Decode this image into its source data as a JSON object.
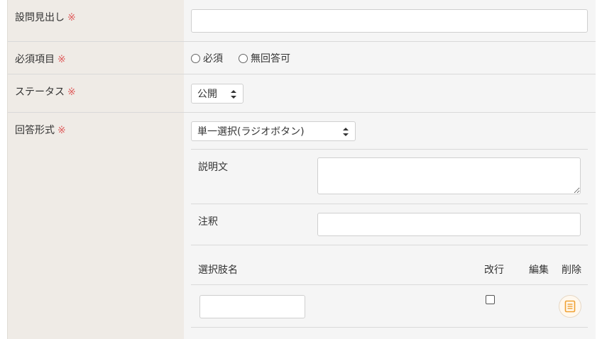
{
  "form": {
    "required_mark": "※",
    "question_title": {
      "label": "設問見出し",
      "value": ""
    },
    "required_item": {
      "label": "必須項目",
      "options": [
        "必須",
        "無回答可"
      ]
    },
    "status": {
      "label": "ステータス",
      "selected": "公開"
    },
    "answer_format": {
      "label": "回答形式",
      "selected": "単一選択(ラジオボタン)",
      "description": {
        "label": "説明文",
        "value": ""
      },
      "note": {
        "label": "注釈",
        "value": ""
      },
      "choices_table": {
        "headers": {
          "name": "選択肢名",
          "line_break": "改行",
          "edit": "編集",
          "delete": "削除"
        },
        "rows": [
          {
            "name": "",
            "line_break": false
          }
        ]
      }
    }
  },
  "colors": {
    "required_mark": "#e06060",
    "label_bg": "#efebe6",
    "field_bg": "#f5f5f5",
    "memo_icon": "#f0a030"
  }
}
